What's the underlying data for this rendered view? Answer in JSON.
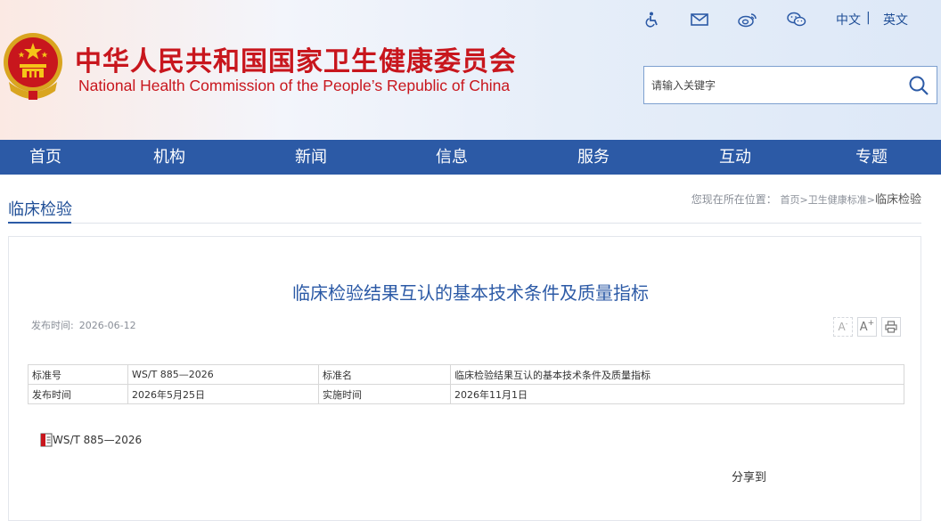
{
  "header": {
    "title_cn": "中华人民共和国国家卫生健康委员会",
    "title_en": "National Health Commission of the People’s  Republic of China",
    "lang_cn": "中文",
    "lang_sep": "|",
    "lang_en": "英文",
    "icons": [
      "accessibility-icon",
      "mail-icon",
      "weibo-icon",
      "wechat-icon"
    ],
    "search_placeholder": "请输入关键字"
  },
  "nav": {
    "items": [
      "首页",
      "机构",
      "新闻",
      "信息",
      "服务",
      "互动",
      "专题"
    ]
  },
  "column": {
    "title": "临床检验",
    "location_label": "您现在所在位置：",
    "crumbs": "首页>卫生健康标准>",
    "current": "临床检验"
  },
  "article": {
    "title": "临床检验结果互认的基本技术条件及质量指标",
    "pubdate_label": "发布时间:",
    "pubdate": "2026-06-12",
    "tools": [
      "A-",
      "A+",
      "print"
    ],
    "meta": {
      "row1": [
        "标准号",
        "WS/T 885—2026",
        "标准名",
        "临床检验结果互认的基本技术条件及质量指标"
      ],
      "row2": [
        "发布时间",
        "2026年5月25日",
        "实施时间",
        "2026年11月1日"
      ]
    },
    "attachment": "WS/T 885—2026",
    "share_label": "分享到"
  },
  "colors": {
    "brand_red": "#c8161d",
    "nav_blue": "#2c5aa6",
    "link_blue": "#1f4e96"
  }
}
